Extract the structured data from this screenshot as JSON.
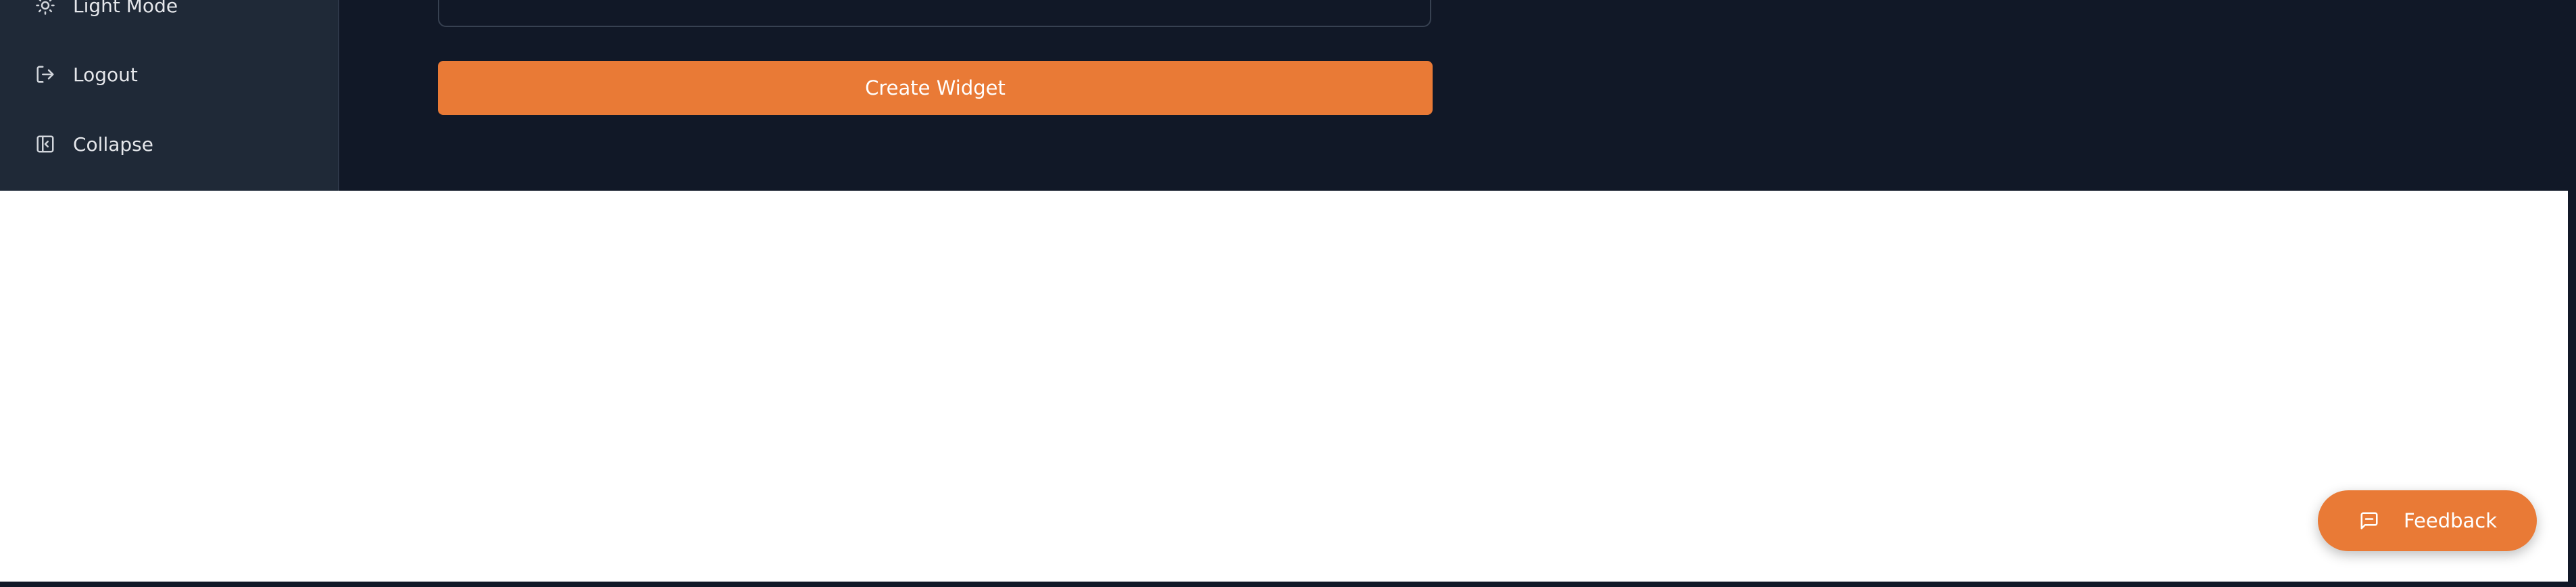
{
  "sidebar": {
    "items": [
      {
        "label": "Light Mode",
        "icon": "sun-icon"
      },
      {
        "label": "Logout",
        "icon": "logout-icon"
      },
      {
        "label": "Collapse",
        "icon": "collapse-panel-icon"
      }
    ]
  },
  "form": {
    "submit_label": "Create Widget"
  },
  "feedback": {
    "label": "Feedback",
    "icon": "message-square-icon"
  },
  "colors": {
    "accent": "#e97a36",
    "background_dark": "#111827",
    "sidebar_bg": "#1f2937",
    "content_bg": "#ffffff"
  }
}
